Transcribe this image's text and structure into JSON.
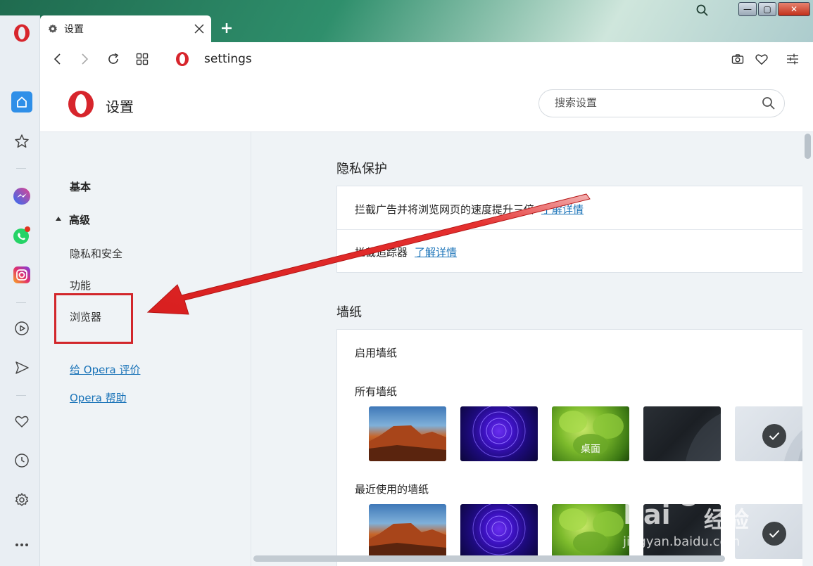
{
  "window": {
    "minimize": "—",
    "maximize": "▢",
    "close": "✕"
  },
  "tab": {
    "title": "设置"
  },
  "address": {
    "url": "settings"
  },
  "header": {
    "title": "设置",
    "search_placeholder": "搜索设置"
  },
  "nav": {
    "basic": "基本",
    "advanced": "高级",
    "privacy": "隐私和安全",
    "features": "功能",
    "browser": "浏览器",
    "rate": "给 Opera 评价",
    "help": "Opera 帮助"
  },
  "privacy_section": {
    "title": "隐私保护",
    "row1_text": "拦截广告并将浏览网页的速度提升三倍",
    "row1_link": "了解详情",
    "row2_text": "拦截追踪器",
    "row2_link": "了解详情"
  },
  "wallpaper_section": {
    "title": "墙纸",
    "enable": "启用墙纸",
    "all": "所有墙纸",
    "recent": "最近使用的墙纸",
    "desktop_label": "桌面"
  },
  "watermark": {
    "brand": "Bai",
    "brand_suffix": "经验",
    "url": "jingyan.baidu.com"
  },
  "colors": {
    "opera_red": "#d7252c",
    "link_blue": "#1a73b8",
    "annotation_red": "#d2262b",
    "sidebar_blue": "#2f8fe8"
  }
}
